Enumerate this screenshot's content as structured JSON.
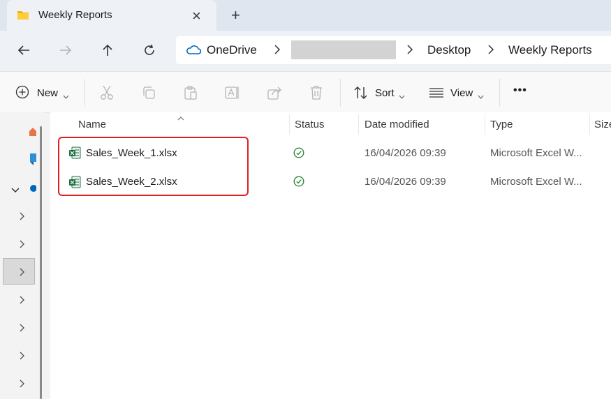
{
  "window": {
    "tab_title": "Weekly Reports",
    "new_tab": "+",
    "close": "×"
  },
  "address": {
    "root": "OneDrive",
    "hidden_segment": "",
    "segments": [
      "Desktop",
      "Weekly Reports"
    ]
  },
  "toolbar": {
    "new_label": "New",
    "sort_label": "Sort",
    "view_label": "View",
    "more": "•••"
  },
  "columns": {
    "name": "Name",
    "status": "Status",
    "date": "Date modified",
    "type": "Type",
    "size": "Size"
  },
  "files": [
    {
      "name": "Sales_Week_1.xlsx",
      "date": "16/04/2026 09:39",
      "type": "Microsoft Excel W..."
    },
    {
      "name": "Sales_Week_2.xlsx",
      "date": "16/04/2026 09:39",
      "type": "Microsoft Excel W..."
    }
  ],
  "colors": {
    "accent": "#0067c0",
    "status_green": "#2c8a3a",
    "highlight": "#e02020",
    "excel_green": "#1d6f42"
  }
}
